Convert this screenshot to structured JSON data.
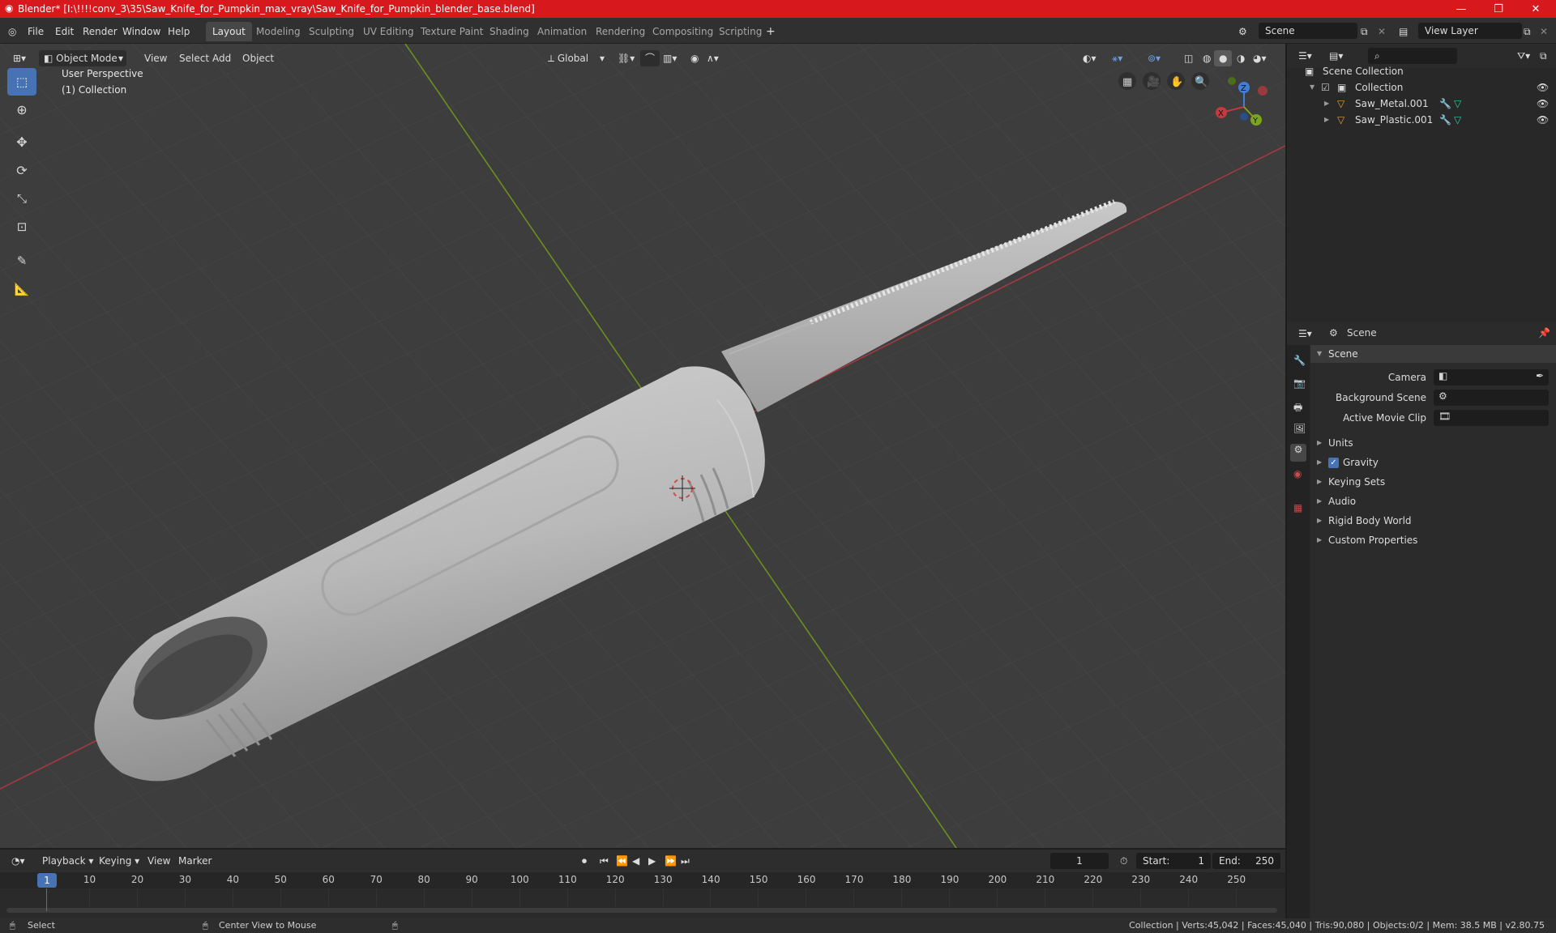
{
  "window": {
    "title": "Blender* [I:\\!!!!conv_3\\35\\Saw_Knife_for_Pumpkin_max_vray\\Saw_Knife_for_Pumpkin_blender_base.blend]",
    "minimize": "—",
    "maximize": "❐",
    "close": "✕"
  },
  "menu": [
    "File",
    "Edit",
    "Render",
    "Window",
    "Help"
  ],
  "workspaces": [
    "Layout",
    "Modeling",
    "Sculpting",
    "UV Editing",
    "Texture Paint",
    "Shading",
    "Animation",
    "Rendering",
    "Compositing",
    "Scripting"
  ],
  "active_workspace": "Layout",
  "add_workspace": "+",
  "scene_field": "Scene",
  "view_layer_field": "View Layer",
  "viewport": {
    "mode": "Object Mode",
    "menus": [
      "View",
      "Select",
      "Add",
      "Object"
    ],
    "orientation": "Global",
    "overlay_line1": "User Perspective",
    "overlay_line2": "(1) Collection",
    "gizmo": {
      "x": "X",
      "y": "Y",
      "z": "Z"
    }
  },
  "outliner": {
    "root": "Scene Collection",
    "collection": "Collection",
    "objects": [
      "Saw_Metal.001",
      "Saw_Plastic.001"
    ]
  },
  "properties": {
    "header": "Scene",
    "panel": "Scene",
    "fields": [
      "Camera",
      "Background Scene",
      "Active Movie Clip"
    ],
    "sections": [
      "Units",
      "Gravity",
      "Keying Sets",
      "Audio",
      "Rigid Body World",
      "Custom Properties"
    ]
  },
  "timeline": {
    "menus": [
      "Playback",
      "Keying",
      "View",
      "Marker"
    ],
    "current_frame": "1",
    "start_label": "Start:",
    "start_value": "1",
    "end_label": "End:",
    "end_value": "250",
    "playhead": "1",
    "ticks": [
      "10",
      "20",
      "30",
      "40",
      "50",
      "60",
      "70",
      "80",
      "90",
      "100",
      "110",
      "120",
      "130",
      "140",
      "150",
      "160",
      "170",
      "180",
      "190",
      "200",
      "210",
      "220",
      "230",
      "240",
      "250"
    ]
  },
  "status": {
    "left1": "Select",
    "left2": "Center View to Mouse",
    "right": "Collection | Verts:45,042 | Faces:45,040 | Tris:90,080 | Objects:0/2 | Mem: 38.5 MB | v2.80.75"
  },
  "colors": {
    "titlebar": "#d7181c",
    "accent": "#4772b3",
    "x_axis": "#c43a3e",
    "y_axis": "#7aa51c",
    "z_axis": "#3f7fd9"
  }
}
